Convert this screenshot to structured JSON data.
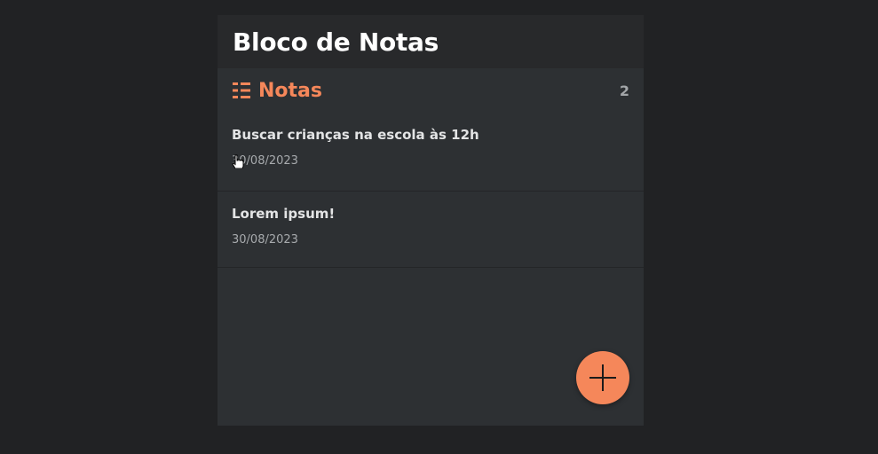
{
  "app": {
    "title": "Bloco de Notas"
  },
  "notes_section": {
    "icon": "list-icon",
    "title": "Notas",
    "count": "2",
    "accent_color": "#f5875a"
  },
  "notes": [
    {
      "title": "Buscar crianças na escola às 12h",
      "date": "30/08/2023"
    },
    {
      "title": "Lorem ipsum!",
      "date": "30/08/2023"
    }
  ],
  "fab": {
    "icon": "plus-icon",
    "color": "#f5875a"
  }
}
